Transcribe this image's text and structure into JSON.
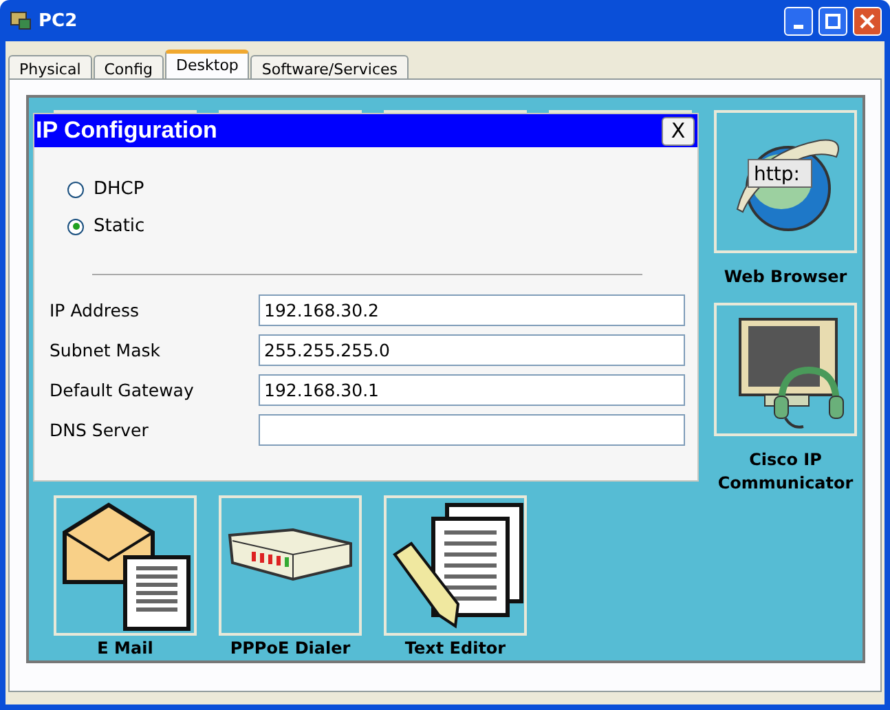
{
  "window": {
    "title": "PC2"
  },
  "tabs": [
    {
      "label": "Physical",
      "selected": false
    },
    {
      "label": "Config",
      "selected": false
    },
    {
      "label": "Desktop",
      "selected": true
    },
    {
      "label": "Software/Services",
      "selected": false
    }
  ],
  "apps": [
    {
      "kind": "browser",
      "label": "Web Browser",
      "icon_text": "http:"
    },
    {
      "kind": "phone",
      "label": "Cisco IP Communicator"
    },
    {
      "kind": "email",
      "label": "E Mail"
    },
    {
      "kind": "dialer",
      "label": "PPPoE Dialer"
    },
    {
      "kind": "editor",
      "label": "Text Editor"
    }
  ],
  "dialog": {
    "title": "IP Configuration",
    "close": "X",
    "modes": [
      {
        "label": "DHCP",
        "selected": false
      },
      {
        "label": "Static",
        "selected": true
      }
    ],
    "fields": [
      {
        "label": "IP Address",
        "value": "192.168.30.2"
      },
      {
        "label": "Subnet Mask",
        "value": "255.255.255.0"
      },
      {
        "label": "Default Gateway",
        "value": "192.168.30.1"
      },
      {
        "label": "DNS Server"
      }
    ]
  }
}
